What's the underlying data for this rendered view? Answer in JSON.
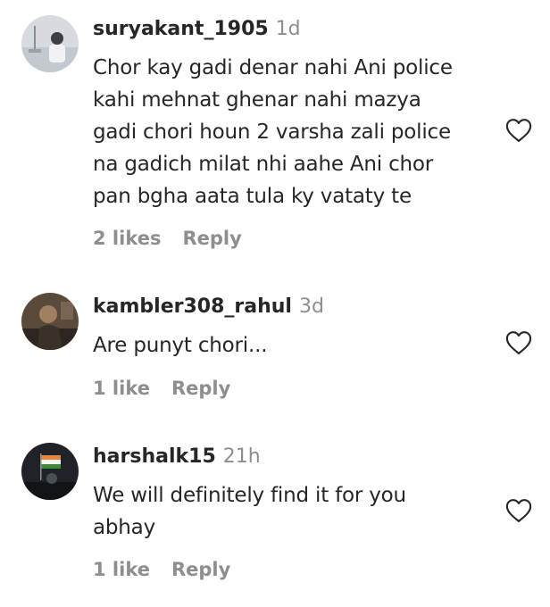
{
  "comments": [
    {
      "username": "suryakant_1905",
      "time": "1d",
      "text_lines": [
        "Chor kay gadi denar nahi Ani police",
        "kahi mehnat ghenar nahi mazya",
        "gadi chori houn 2 varsha zali police",
        "na gadich milat nhi aahe Ani chor",
        "pan bgha aata tula ky vataty te"
      ],
      "likes": "2 likes",
      "reply": "Reply",
      "like_icon": "heart-outline-icon"
    },
    {
      "username": "kambler308_rahul",
      "time": "3d",
      "text_lines": [
        "Are punyt chori..."
      ],
      "likes": "1 like",
      "reply": "Reply",
      "like_icon": "heart-outline-icon"
    },
    {
      "username": "harshalk15",
      "time": "21h",
      "text_lines": [
        "We will definitely find it for you",
        "abhay"
      ],
      "likes": "1 like",
      "reply": "Reply",
      "like_icon": "heart-outline-icon"
    }
  ],
  "colors": {
    "text": "#262626",
    "muted": "#8e8e8e",
    "background": "#ffffff"
  }
}
